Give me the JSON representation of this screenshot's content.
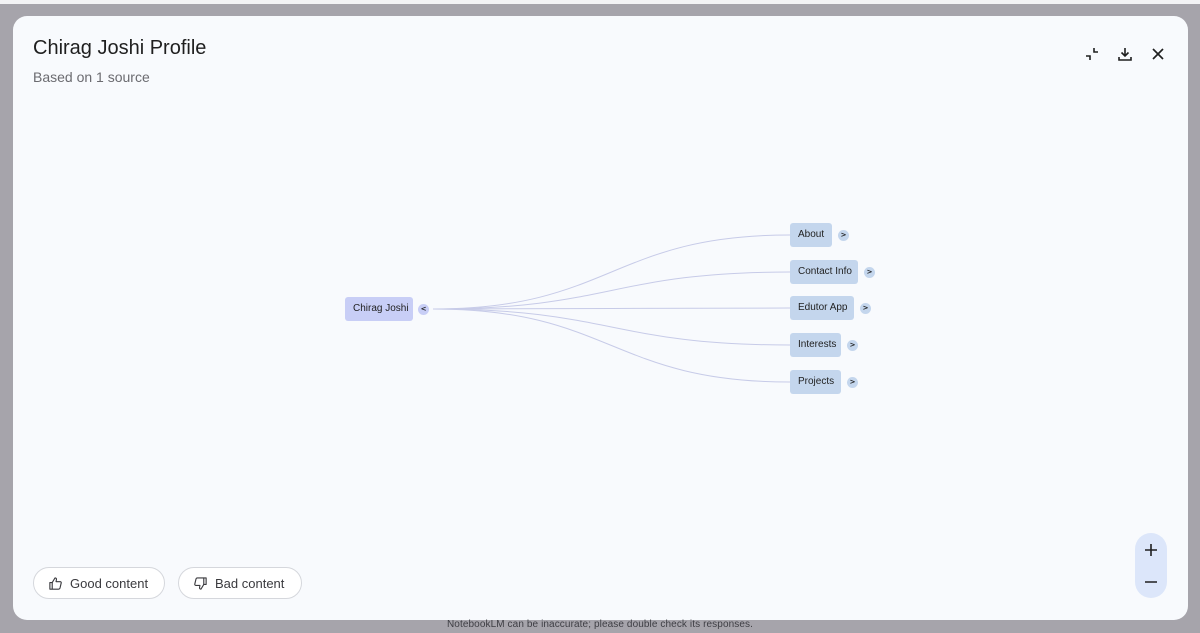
{
  "dialog": {
    "title": "Chirag Joshi Profile",
    "subtitle": "Based on 1 source"
  },
  "toolbar": {
    "collapse_icon": "collapse-icon",
    "download_icon": "download-icon",
    "close_icon": "close-icon"
  },
  "mindmap": {
    "root": {
      "label": "Chirag Joshi",
      "toggle": "<"
    },
    "children": [
      {
        "label": "About",
        "toggle": ">"
      },
      {
        "label": "Contact Info",
        "toggle": ">"
      },
      {
        "label": "Edutor App",
        "toggle": ">"
      },
      {
        "label": "Interests",
        "toggle": ">"
      },
      {
        "label": "Projects",
        "toggle": ">"
      }
    ],
    "colors": {
      "root_fill": "#c8cef6",
      "child_fill": "#c4d6ed",
      "edge": "#c7cbe8"
    }
  },
  "feedback": {
    "good_label": "Good content",
    "bad_label": "Bad content"
  },
  "zoom": {
    "in_icon": "plus-icon",
    "out_icon": "minus-icon"
  },
  "footer": {
    "disclaimer": "NotebookLM can be inaccurate; please double check its responses."
  }
}
